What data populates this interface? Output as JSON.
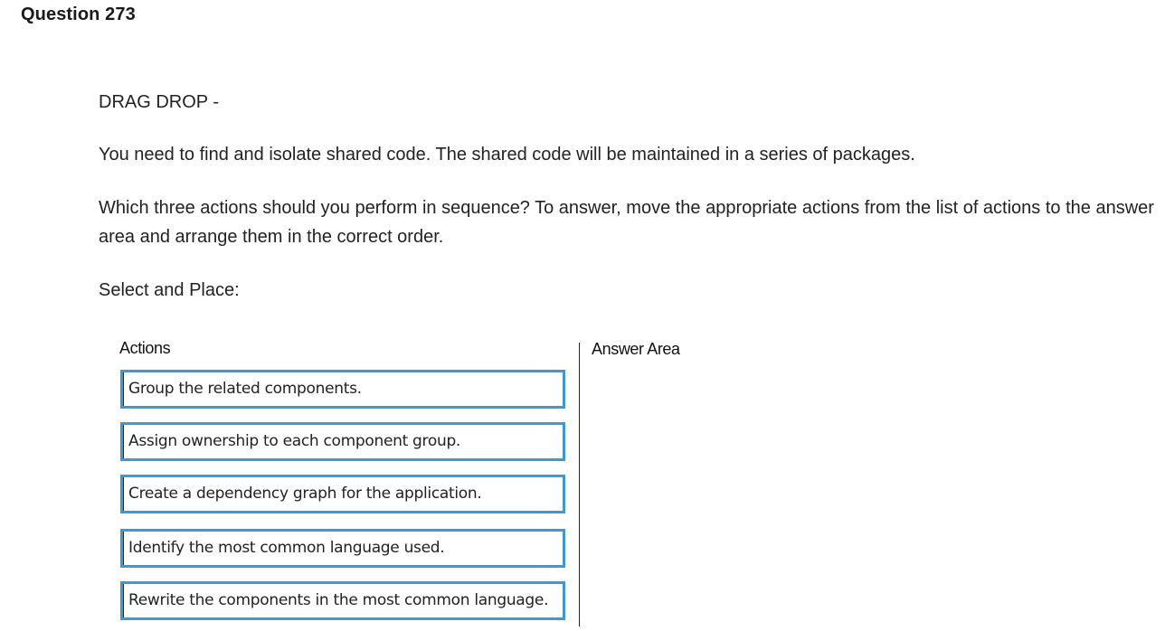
{
  "question": {
    "title": "Question 273",
    "type_label": "DRAG DROP -",
    "stem": "You need to find and isolate shared code. The shared code will be maintained in a series of packages.",
    "prompt": "Which three actions should you perform in sequence? To answer, move the appropriate actions from the list of actions to the answer area and arrange them in the correct order.",
    "instruction": "Select and Place:"
  },
  "drag_drop": {
    "actions_heading": "Actions",
    "answer_heading": "Answer Area",
    "actions": [
      "Group the related components.",
      "Assign ownership to each component group.",
      "Create a dependency graph for the application.",
      "Identify the most common language used.",
      "Rewrite the components in the most common language."
    ],
    "answer_items": []
  },
  "colors": {
    "item_border": "#3a9ad6",
    "text": "#222222",
    "background": "#ffffff"
  }
}
